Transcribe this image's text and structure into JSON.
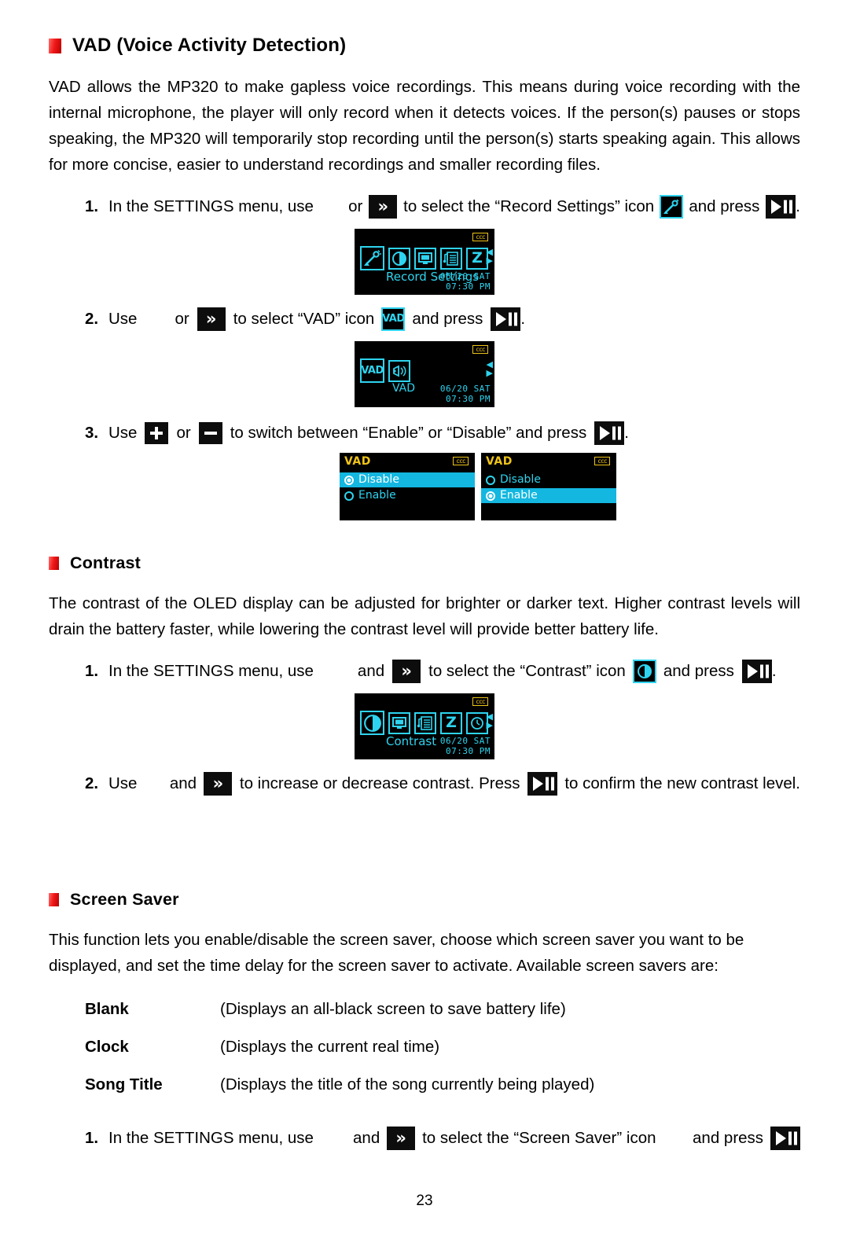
{
  "page": {
    "number": "23"
  },
  "sections": {
    "vad": {
      "heading": "VAD (Voice Activity Detection)",
      "paragraph": "VAD allows the MP320 to make gapless voice recordings. This means during voice recording with the internal microphone, the player will only record when it detects voices. If the person(s) pauses or stops speaking, the MP320 will temporarily stop recording until the person(s) starts speaking again. This allows for more concise, easier to understand recordings and smaller recording files.",
      "steps": [
        {
          "num": "1.",
          "part1": "In the SETTINGS menu, use",
          "conj": "or",
          "part2": "to select the “Record Settings” icon",
          "part3": "and press",
          "end": "."
        },
        {
          "num": "2.",
          "part1": "Use",
          "conj": "or",
          "part2": "to select “VAD” icon",
          "part3": "and press",
          "end": "."
        },
        {
          "num": "3.",
          "part1": "Use",
          "conj": "or",
          "part2": "to switch between “Enable” or “Disable” and press",
          "end": "."
        }
      ],
      "screen_record_settings": {
        "label": "Record Settings",
        "date": "06/20 SAT",
        "time": "07:30 PM",
        "battery": "ccc",
        "icons": [
          "microphone-icon",
          "contrast-icon",
          "display-icon",
          "playlist-icon",
          "sleep-z-icon"
        ]
      },
      "screen_vad": {
        "label": "VAD",
        "selected_icon_text": "VAD",
        "date": "06/20 SAT",
        "time": "07:30 PM",
        "battery": "ccc",
        "icons": [
          "vad-icon",
          "mic-sensitivity-icon"
        ]
      },
      "option_screens": [
        {
          "title": "VAD",
          "battery": "ccc",
          "options": [
            {
              "label": "Disable",
              "selected": true,
              "highlighted": true
            },
            {
              "label": "Enable",
              "selected": false,
              "highlighted": false
            }
          ]
        },
        {
          "title": "VAD",
          "battery": "ccc",
          "options": [
            {
              "label": "Disable",
              "selected": false,
              "highlighted": false
            },
            {
              "label": "Enable",
              "selected": true,
              "highlighted": true
            }
          ]
        }
      ]
    },
    "contrast": {
      "heading": "Contrast",
      "paragraph": "The contrast of the OLED display can be adjusted for brighter or darker text.  Higher contrast levels will drain the battery faster, while lowering the contrast level will provide better battery life.",
      "steps": [
        {
          "num": "1.",
          "part1": "In the SETTINGS menu, use",
          "conj": "and",
          "part2": "to select the “Contrast” icon",
          "part3": "and press",
          "end": "."
        },
        {
          "num": "2.",
          "part1": "Use",
          "conj": "and",
          "part2": "to increase or decrease contrast. Press",
          "part3": "to confirm the new contrast level.",
          "end": ""
        }
      ],
      "screen_contrast": {
        "label": "Contrast",
        "date": "06/20 SAT",
        "time": "07:30 PM",
        "battery": "ccc",
        "icons": [
          "contrast-icon",
          "display-icon",
          "playlist-icon",
          "sleep-z-icon",
          "clock-icon"
        ]
      }
    },
    "screen_saver": {
      "heading": "Screen Saver",
      "paragraph": "This function lets you enable/disable the screen saver, choose which screen saver you want to be displayed, and set the time delay for the screen saver to activate.    Available screen savers are:",
      "definitions": [
        {
          "term": "Blank",
          "desc": "(Displays an all-black screen to save battery life)"
        },
        {
          "term": "Clock",
          "desc": "(Displays the current real time)"
        },
        {
          "term": "Song Title",
          "desc": "(Displays the title of the song currently being played)"
        }
      ],
      "steps": [
        {
          "num": "1.",
          "part1": "In the SETTINGS menu, use",
          "conj": "and",
          "part2": "to select the “Screen Saver” icon",
          "part3": "and press",
          "end": ""
        }
      ]
    }
  },
  "colors": {
    "bullet_red": "#f21919",
    "oled_cyan": "#2ed4ef",
    "oled_yellow": "#f0c419",
    "highlight_blue": "#13b7e0",
    "screen_black": "#000000"
  }
}
